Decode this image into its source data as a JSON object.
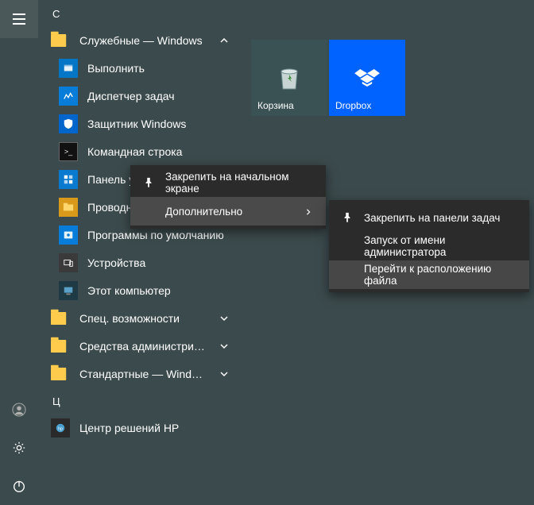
{
  "letters": {
    "c": "С",
    "ts": "Ц"
  },
  "folders": {
    "system": "Служебные — Windows",
    "accessibility": "Спец. возможности",
    "admin": "Средства администрировани…",
    "standard": "Стандартные — Windows"
  },
  "apps": {
    "run": "Выполнить",
    "taskmgr": "Диспетчер задач",
    "defender": "Защитник Windows",
    "cmd": "Командная строка",
    "ctrl": "Панель управления",
    "explorer": "Проводник",
    "defaults": "Программы по умолчанию",
    "devices": "Устройства",
    "pc": "Этот компьютер",
    "hp": "Центр решений HP"
  },
  "tiles": {
    "recycle": "Корзина",
    "dropbox": "Dropbox"
  },
  "ctx1": {
    "pin_start": "Закрепить на начальном экране",
    "more": "Дополнительно"
  },
  "ctx2": {
    "pin_taskbar": "Закрепить на панели задач",
    "run_admin": "Запуск от имени администратора",
    "open_loc": "Перейти к расположению файла"
  }
}
